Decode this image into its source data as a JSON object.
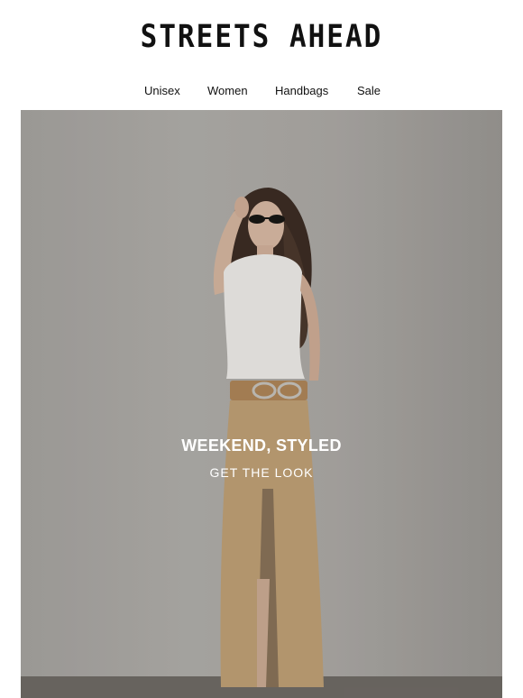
{
  "brand": {
    "logo_text": "STREETS AHEAD"
  },
  "nav": {
    "items": [
      {
        "label": "Unisex"
      },
      {
        "label": "Women"
      },
      {
        "label": "Handbags"
      },
      {
        "label": "Sale"
      }
    ]
  },
  "hero": {
    "title": "WEEKEND, STYLED",
    "cta": "GET THE LOOK",
    "image_subject": "model-wearing-white-top-and-tan-maxi-skirt"
  },
  "colors": {
    "background": "#ffffff",
    "text": "#111111",
    "hero_text": "#ffffff"
  }
}
